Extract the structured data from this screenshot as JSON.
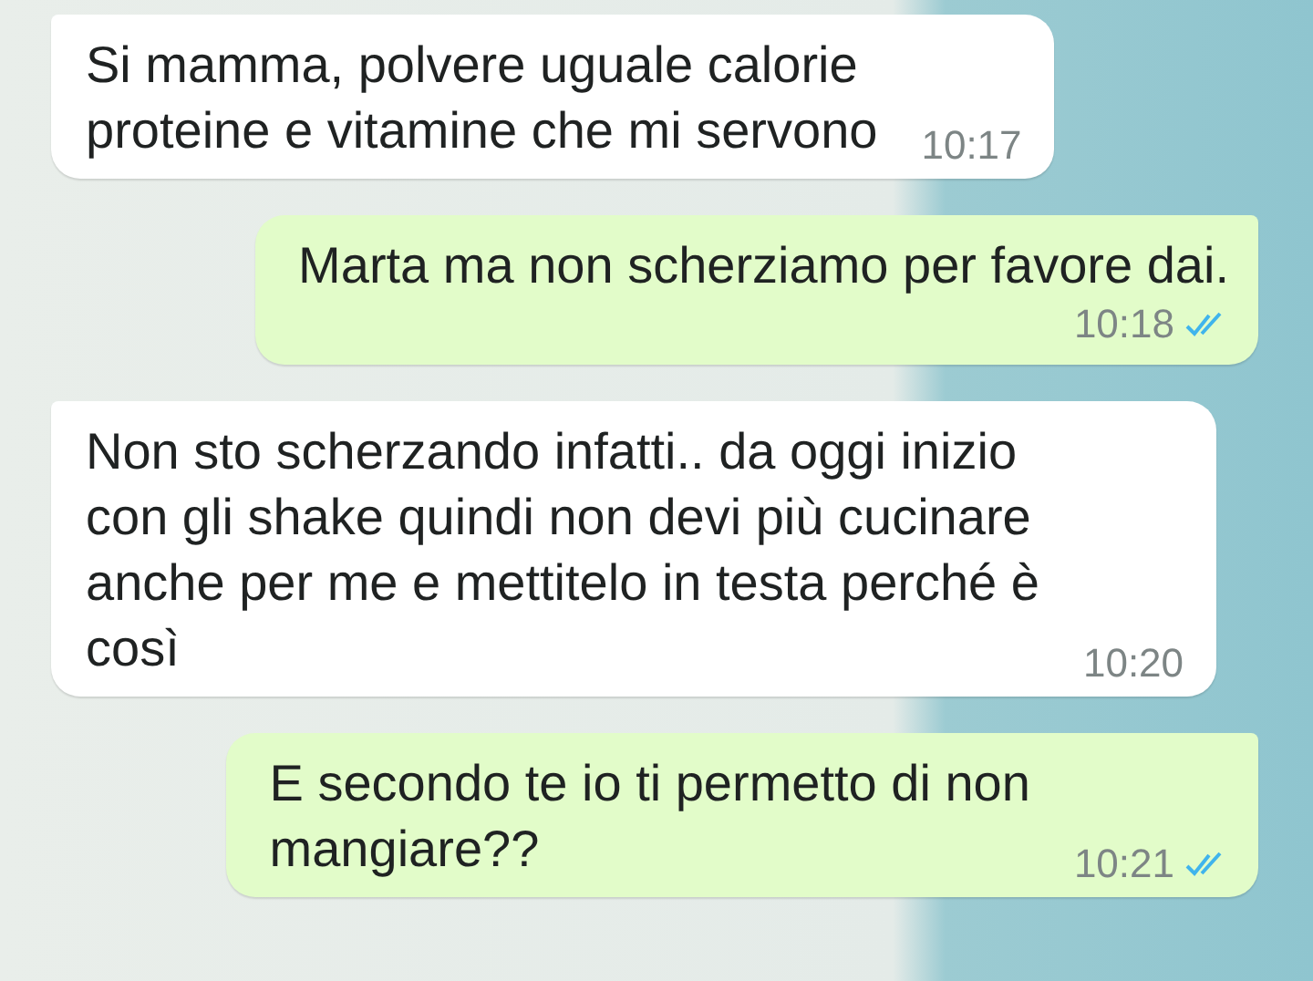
{
  "messages": [
    {
      "kind": "incoming",
      "text": "Si mamma, polvere uguale calorie\nproteine e vitamine che mi servono",
      "time": "10:17"
    },
    {
      "kind": "outgoing",
      "text": "Marta ma non scherziamo per favore dai.",
      "time": "10:18",
      "read": true
    },
    {
      "kind": "incoming",
      "text": "Non sto scherzando infatti.. da oggi inizio\ncon gli shake quindi non devi più cucinare\nanche per me e mettitelo in testa perché è\ncosì",
      "time": "10:20"
    },
    {
      "kind": "outgoing",
      "text": "E secondo te io ti permetto di non\nmangiare??",
      "time": "10:21",
      "read": true
    }
  ]
}
